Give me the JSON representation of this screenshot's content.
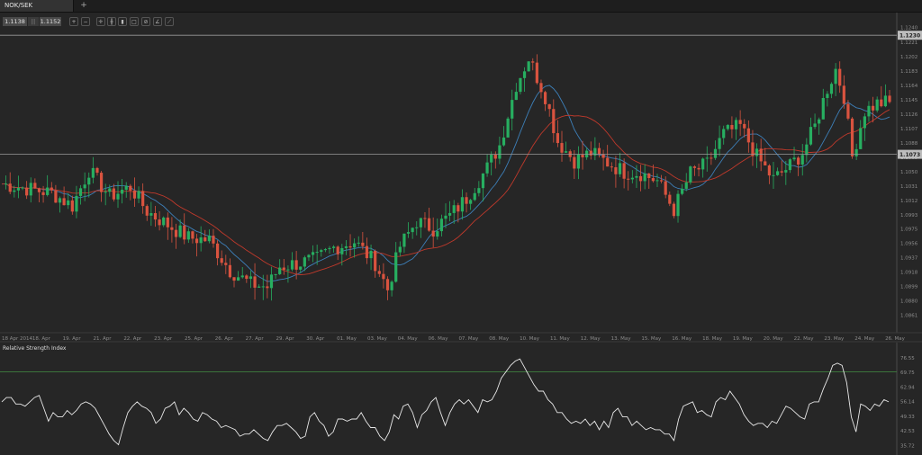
{
  "tab": {
    "label": "NOK/SEK",
    "add": "+"
  },
  "quote": {
    "bid": "1.1138",
    "separator": "||",
    "ask": "1.1152"
  },
  "tools": [
    "zoom-in-icon",
    "zoom-out-icon",
    "crosshair-icon",
    "bar-type-icon",
    "candles-icon",
    "line-type-icon",
    "indicator-icon",
    "draw-icon",
    "trendline-icon"
  ],
  "colors": {
    "bull": "#27ae60",
    "bear": "#d9533f",
    "ma_fast": "#3d7fb8",
    "ma_slow": "#c0392b",
    "rsi": "#e8e8e8",
    "rsi_upper": "#3f7f3f",
    "rsi_lower": "#9a2b2b"
  },
  "chart_data": [
    {
      "type": "candlestick",
      "title": "NOK/SEK",
      "y_ticks": [
        "1.1240",
        "1.1221",
        "1.1202",
        "1.1183",
        "1.1164",
        "1.1145",
        "1.1126",
        "1.1107",
        "1.1088",
        "1.1069",
        "1.1050",
        "1.1031",
        "1.1012",
        "1.0993",
        "1.0975",
        "1.0956",
        "1.0937",
        "1.0918",
        "1.0899",
        "1.0880",
        "1.0861"
      ],
      "ylim": [
        1.0852,
        1.1248
      ],
      "x_labels": [
        "18 Apr 2014",
        "18. Apr",
        "19. Apr",
        "21. Apr",
        "22. Apr",
        "23. Apr",
        "25. Apr",
        "26. Apr",
        "27. Apr",
        "29. Apr",
        "30. Apr",
        "01. May",
        "03. May",
        "04. May",
        "06. May",
        "07. May",
        "08. May",
        "10. May",
        "11. May",
        "12. May",
        "13. May",
        "15. May",
        "16. May",
        "18. May",
        "19. May",
        "20. May",
        "22. May",
        "23. May",
        "24. May",
        "26. May"
      ],
      "horizontal_lines": [
        {
          "value": 1.123,
          "label": "1.1230"
        },
        {
          "value": 1.1073,
          "label": "1.1073"
        }
      ],
      "anchors": [
        [
          0,
          1.1034
        ],
        [
          6,
          1.1028
        ],
        [
          12,
          1.1022
        ],
        [
          17,
          1.1005
        ],
        [
          21,
          1.1052
        ],
        [
          26,
          1.1018
        ],
        [
          31,
          1.103
        ],
        [
          35,
          1.0998
        ],
        [
          40,
          1.098
        ],
        [
          45,
          1.0963
        ],
        [
          50,
          1.096
        ],
        [
          55,
          1.092
        ],
        [
          60,
          1.0902
        ],
        [
          64,
          1.0898
        ],
        [
          67,
          1.0925
        ],
        [
          72,
          1.093
        ],
        [
          76,
          1.0935
        ],
        [
          80,
          1.095
        ],
        [
          85,
          1.0958
        ],
        [
          90,
          1.093
        ],
        [
          93,
          1.0895
        ],
        [
          96,
          1.0952
        ],
        [
          100,
          1.0985
        ],
        [
          104,
          1.0975
        ],
        [
          108,
          1.0992
        ],
        [
          112,
          1.1015
        ],
        [
          117,
          1.1055
        ],
        [
          120,
          1.1085
        ],
        [
          124,
          1.1165
        ],
        [
          127,
          1.12
        ],
        [
          131,
          1.115
        ],
        [
          134,
          1.109
        ],
        [
          138,
          1.1065
        ],
        [
          142,
          1.1075
        ],
        [
          146,
          1.1062
        ],
        [
          150,
          1.105
        ],
        [
          154,
          1.1048
        ],
        [
          158,
          1.1038
        ],
        [
          162,
          1.1
        ],
        [
          166,
          1.1048
        ],
        [
          170,
          1.106
        ],
        [
          174,
          1.11
        ],
        [
          178,
          1.111
        ],
        [
          182,
          1.107
        ],
        [
          186,
          1.104
        ],
        [
          190,
          1.1058
        ],
        [
          193,
          1.1075
        ],
        [
          196,
          1.111
        ],
        [
          199,
          1.116
        ],
        [
          201,
          1.1185
        ],
        [
          203,
          1.115
        ],
        [
          205,
          1.107
        ],
        [
          208,
          1.113
        ],
        [
          211,
          1.114
        ],
        [
          214,
          1.1142
        ]
      ],
      "moving_averages": [
        {
          "period": 10,
          "color": "#3d7fb8"
        },
        {
          "period": 20,
          "color": "#c0392b"
        }
      ]
    },
    {
      "type": "line",
      "title": "Relative Strength Index",
      "y_ticks": [
        "76.55",
        "69.75",
        "62.94",
        "56.14",
        "49.33",
        "42.53",
        "35.72"
      ],
      "ylim": [
        32.5,
        79.0
      ],
      "overbought": 70,
      "oversold": 30,
      "values": [
        56,
        58,
        58,
        55,
        55,
        54,
        56,
        58,
        59,
        53,
        47,
        51,
        49,
        49,
        52,
        50,
        52,
        55,
        56,
        55,
        53,
        49,
        45,
        41,
        38,
        36,
        44,
        51,
        54,
        56,
        54,
        53,
        51,
        46,
        48,
        53,
        54,
        56,
        50,
        53,
        51,
        48,
        47,
        51,
        50,
        48,
        47,
        44,
        45,
        44,
        43,
        40,
        41,
        41,
        43,
        41,
        39,
        38,
        42,
        45,
        45,
        46,
        44,
        42,
        39,
        40,
        49,
        51,
        47,
        45,
        40,
        42,
        48,
        48,
        47,
        48,
        48,
        51,
        47,
        44,
        44,
        40,
        38,
        42,
        50,
        48,
        54,
        55,
        51,
        44,
        50,
        52,
        56,
        58,
        51,
        45,
        51,
        55,
        57,
        55,
        57,
        54,
        51,
        57,
        56,
        57,
        61,
        67,
        70,
        73,
        75,
        76,
        72,
        68,
        64,
        61,
        61,
        57,
        55,
        51,
        51,
        48,
        46,
        47,
        46,
        48,
        45,
        47,
        43,
        47,
        44,
        51,
        53,
        49,
        49,
        45,
        47,
        45,
        43,
        44,
        43,
        43,
        41,
        41,
        38,
        48,
        54,
        55,
        56,
        51,
        52,
        50,
        49,
        56,
        58,
        57,
        61,
        58,
        55,
        50,
        47,
        45,
        46,
        46,
        44,
        47,
        46,
        50,
        54,
        53,
        51,
        49,
        48,
        55,
        56,
        56,
        62,
        67,
        73,
        74,
        73,
        65,
        49,
        42,
        55,
        54,
        52,
        55,
        54,
        57,
        56
      ]
    }
  ]
}
